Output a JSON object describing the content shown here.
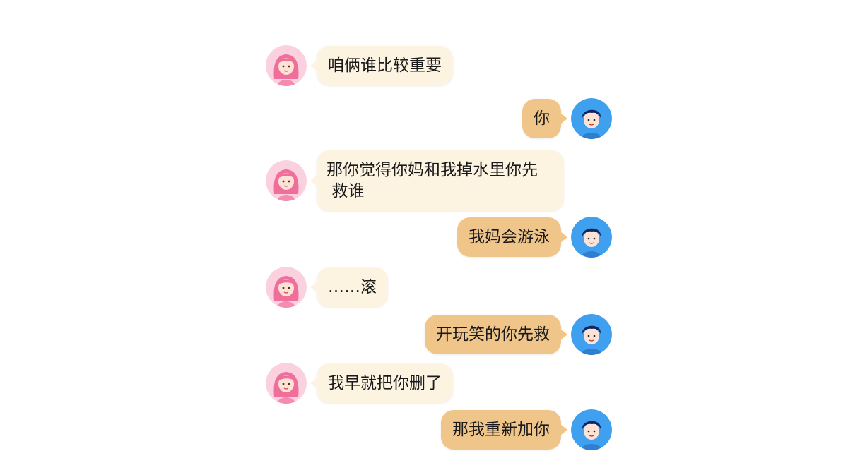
{
  "colors": {
    "left_bubble": "#fdf3e1",
    "right_bubble": "#efc58a",
    "female_avatar_bg": "#fbd1df",
    "male_avatar_bg": "#3fa0f0"
  },
  "messages": [
    {
      "side": "left",
      "avatar": "girl-avatar",
      "text": "咱俩谁比较重要"
    },
    {
      "side": "right",
      "avatar": "boy-avatar",
      "text": "你"
    },
    {
      "side": "left",
      "avatar": "girl-avatar",
      "text": "那你觉得你妈和我掉水里你先\n 救谁"
    },
    {
      "side": "right",
      "avatar": "boy-avatar",
      "text": "我妈会游泳"
    },
    {
      "side": "left",
      "avatar": "girl-avatar",
      "text": "……滚"
    },
    {
      "side": "right",
      "avatar": "boy-avatar",
      "text": "开玩笑的你先救"
    },
    {
      "side": "left",
      "avatar": "girl-avatar",
      "text": "我早就把你删了"
    },
    {
      "side": "right",
      "avatar": "boy-avatar",
      "text": "那我重新加你"
    }
  ]
}
